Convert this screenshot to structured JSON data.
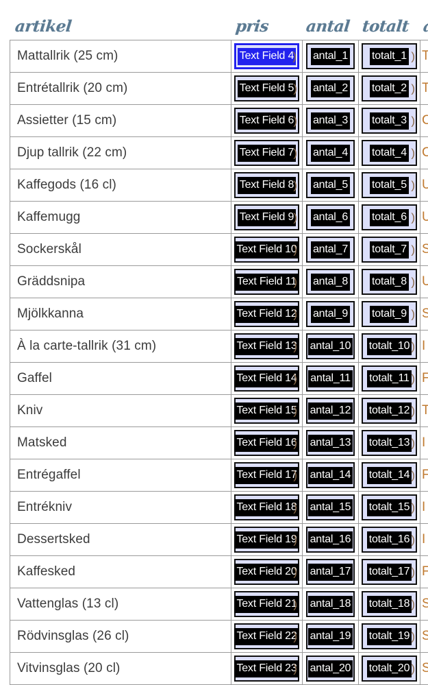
{
  "document": {
    "type": "pdf-form-field-editor",
    "accent_selected": "#2222ee",
    "field_fill": "#dcdffa",
    "header_color": "#5b7a92"
  },
  "headers": {
    "artikel": "artikel",
    "pris": "pris",
    "antal": "antal",
    "totalt": "totalt",
    "extra_partial": "a"
  },
  "rows": [
    {
      "artikel": "Mattallrik (25 cm)",
      "pris": "Text Field 4",
      "antal": "antal_1",
      "totalt": "totalt_1",
      "selected": true,
      "extra": "T"
    },
    {
      "artikel": "Entrétallrik (20 cm)",
      "pris": "Text Field 5",
      "antal": "antal_2",
      "totalt": "totalt_2",
      "selected": false,
      "extra": "T"
    },
    {
      "artikel": "Assietter (15 cm)",
      "pris": "Text Field 6",
      "antal": "antal_3",
      "totalt": "totalt_3",
      "selected": false,
      "extra": "C"
    },
    {
      "artikel": "Djup tallrik (22 cm)",
      "pris": "Text Field 7",
      "antal": "antal_4",
      "totalt": "totalt_4",
      "selected": false,
      "extra": "C"
    },
    {
      "artikel": "Kaffegods (16 cl)",
      "pris": "Text Field 8",
      "antal": "antal_5",
      "totalt": "totalt_5",
      "selected": false,
      "extra": "U"
    },
    {
      "artikel": "Kaffemugg",
      "pris": "Text Field 9",
      "antal": "antal_6",
      "totalt": "totalt_6",
      "selected": false,
      "extra": "U"
    },
    {
      "artikel": "Sockerskål",
      "pris": "Text Field 10",
      "antal": "antal_7",
      "totalt": "totalt_7",
      "selected": false,
      "extra": "S"
    },
    {
      "artikel": "Gräddsnipa",
      "pris": "Text Field 11",
      "antal": "antal_8",
      "totalt": "totalt_8",
      "selected": false,
      "extra": "U"
    },
    {
      "artikel": "Mjölkkanna",
      "pris": "Text Field 12",
      "antal": "antal_9",
      "totalt": "totalt_9",
      "selected": false,
      "extra": "S"
    },
    {
      "artikel": "À la carte-tallrik (31 cm)",
      "pris": "Text Field 13",
      "antal": "antal_10",
      "totalt": "totalt_10",
      "selected": false,
      "extra": "I"
    },
    {
      "artikel": "Gaffel",
      "pris": "Text Field 14",
      "antal": "antal_11",
      "totalt": "totalt_11",
      "selected": false,
      "extra": "F"
    },
    {
      "artikel": "Kniv",
      "pris": "Text Field 15",
      "antal": "antal_12",
      "totalt": "totalt_12",
      "selected": false,
      "extra": "T"
    },
    {
      "artikel": "Matsked",
      "pris": "Text Field 16",
      "antal": "antal_13",
      "totalt": "totalt_13",
      "selected": false,
      "extra": "I"
    },
    {
      "artikel": "Entrégaffel",
      "pris": "Text Field 17",
      "antal": "antal_14",
      "totalt": "totalt_14",
      "selected": false,
      "extra": "F"
    },
    {
      "artikel": "Entrékniv",
      "pris": "Text Field 18",
      "antal": "antal_15",
      "totalt": "totalt_15",
      "selected": false,
      "extra": "I"
    },
    {
      "artikel": "Dessertsked",
      "pris": "Text Field 19",
      "antal": "antal_16",
      "totalt": "totalt_16",
      "selected": false,
      "extra": "I"
    },
    {
      "artikel": "Kaffesked",
      "pris": "Text Field 20",
      "antal": "antal_17",
      "totalt": "totalt_17",
      "selected": false,
      "extra": "F"
    },
    {
      "artikel": "Vattenglas (13 cl)",
      "pris": "Text Field 21",
      "antal": "antal_18",
      "totalt": "totalt_18",
      "selected": false,
      "extra": "S"
    },
    {
      "artikel": "Rödvinsglas (26 cl)",
      "pris": "Text Field 22",
      "antal": "antal_19",
      "totalt": "totalt_19",
      "selected": false,
      "extra": "S"
    },
    {
      "artikel": "Vitvinsglas (20 cl)",
      "pris": "Text Field 23",
      "antal": "antal_20",
      "totalt": "totalt_20",
      "selected": false,
      "extra": "S"
    }
  ]
}
